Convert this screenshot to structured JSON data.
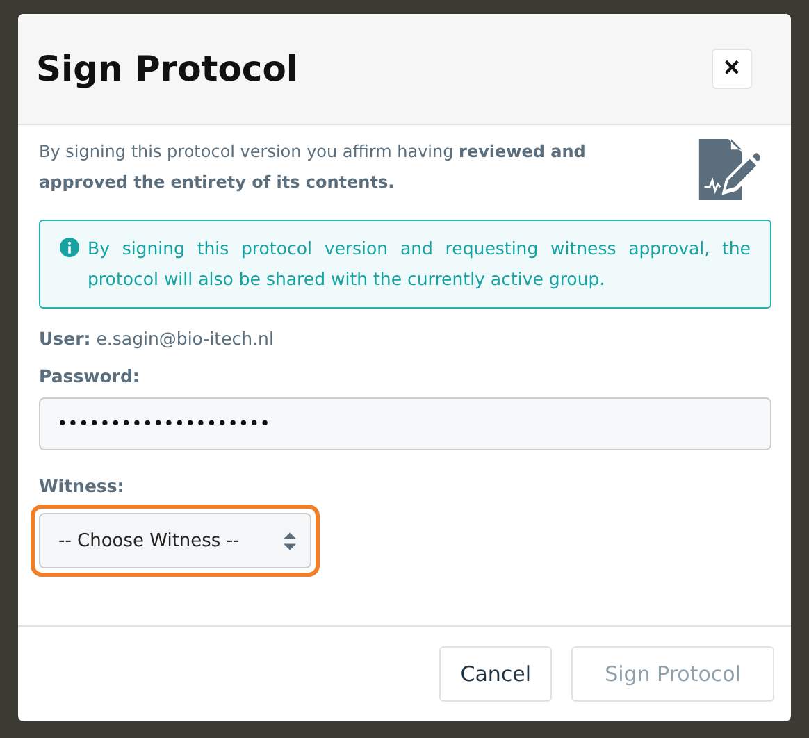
{
  "dialog": {
    "title": "Sign Protocol",
    "close_label": "×",
    "intro": "By signing this protocol version you affirm having **reviewed and approved the entirety of its contents.**",
    "info": "By signing this protocol version and requesting witness approval, the protocol will also be shared with the currently active group.",
    "user_label": "User:",
    "user_value": "e.sagin@bio-itech.nl",
    "password_label": "Password:",
    "password_value": "••••••••••••••••••••",
    "witness_label": "Witness:",
    "witness_value": "-- Choose Witness --",
    "witness_highlighted": true,
    "buttons": [
      {
        "label": "Cancel",
        "disabled": false
      },
      {
        "label": "Sign Protocol",
        "disabled": true
      }
    ]
  }
}
